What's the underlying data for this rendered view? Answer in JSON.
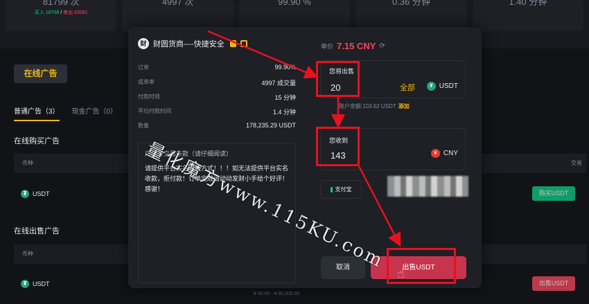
{
  "stats": [
    {
      "value": "81799 次",
      "buy_label": "买入 18708",
      "sell_label": "卖出 63091"
    },
    {
      "value": "4997 次"
    },
    {
      "value": "99.90 %"
    },
    {
      "value": "0.36 分钟"
    },
    {
      "value": "1.40 分钟"
    }
  ],
  "background": {
    "online_tab": "在线广告",
    "tabs": [
      "普通广告（3）",
      "现金广告（0）"
    ],
    "buy_section": "在线购买广告",
    "sell_section": "在线出售广告",
    "col_coin": "币种",
    "col_trade": "交易",
    "coin": "USDT",
    "buy_button": "购买USDT",
    "sell_button": "出售USDT",
    "price_range": "¥ 50.00 - ¥ 80,000.00"
  },
  "modal": {
    "merchant_name": "财圆货商----快捷安全",
    "merchant_avatar": "财",
    "info": [
      {
        "label": "订单",
        "value": "99.90%"
      },
      {
        "label": "成单率",
        "value": "4997 成交量"
      },
      {
        "label": "付款时效",
        "value": "15 分钟"
      },
      {
        "label": "平均付款时间",
        "value": "1.4 分钟"
      },
      {
        "label": "数量",
        "value": "178,235.29 USDT"
      }
    ],
    "terms_title": "广告方交易条款（请仔细阅读）",
    "terms_body": "请提供平台实名收款方式！！！如无法提供平台实名收款，拒付款！订单完成请动动发财小手给个好评！感谢！",
    "price_label": "单价",
    "price_value": "7.15 CNY",
    "sell_label": "您将出售",
    "sell_value": "20",
    "all_label": "全部",
    "sell_currency": "USDT",
    "balance_text": "账户余额:103.62 USDT",
    "add_label": "添加",
    "receive_label": "您收到",
    "receive_value": "143",
    "receive_currency": "CNY",
    "pay_method": "支付宝",
    "cancel_label": "取消",
    "confirm_label": "出售USDT"
  },
  "watermark": "量化魔方www.115KU.com",
  "colors": {
    "accent": "#f0b90b",
    "sell": "#f6465d",
    "buy": "#0ecb81",
    "annotation": "#e8111f"
  }
}
